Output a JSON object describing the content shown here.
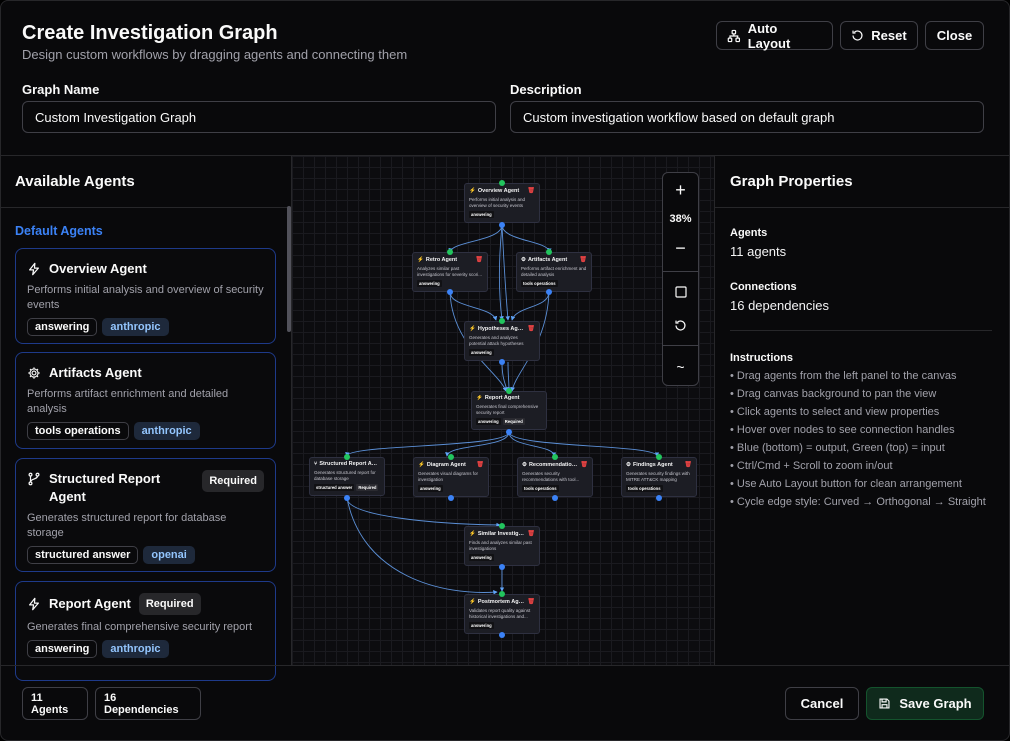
{
  "header": {
    "title": "Create Investigation Graph",
    "subtitle": "Design custom workflows by dragging agents and connecting them",
    "auto_layout_label": "Auto Layout",
    "reset_label": "Reset",
    "close_label": "Close"
  },
  "form": {
    "graph_name_label": "Graph Name",
    "graph_name_value": "Custom Investigation Graph",
    "description_label": "Description",
    "description_value": "Custom investigation workflow based on default graph"
  },
  "left_panel": {
    "title": "Available Agents",
    "section_label": "Default Agents",
    "agents": [
      {
        "name": "Overview Agent",
        "icon": "bolt-icon",
        "description": "Performs initial analysis and overview of security events",
        "tags": [
          "answering",
          "anthropic"
        ],
        "required": ""
      },
      {
        "name": "Artifacts Agent",
        "icon": "gear-icon",
        "description": "Performs artifact enrichment and detailed analysis",
        "tags": [
          "tools operations",
          "anthropic"
        ],
        "required": ""
      },
      {
        "name": "Structured Report Agent",
        "icon": "branch-icon",
        "description": "Generates structured report for database storage",
        "tags": [
          "structured answer",
          "openai"
        ],
        "required": "Required"
      },
      {
        "name": "Report Agent",
        "icon": "bolt-icon",
        "description": "Generates final comprehensive security report",
        "tags": [
          "answering",
          "anthropic"
        ],
        "required": "Required"
      }
    ]
  },
  "canvas": {
    "zoom_label": "38%",
    "nodes": [
      {
        "id": "overview",
        "title": "Overview Agent",
        "desc": "Performs initial analysis and overview of security events",
        "tags": [
          "answering"
        ]
      },
      {
        "id": "retro",
        "title": "Retro Agent",
        "desc": "Analyzes similar past investigations for severity scori...",
        "tags": [
          "answering"
        ]
      },
      {
        "id": "artifacts",
        "title": "Artifacts Agent",
        "desc": "Performs artifact enrichment and detailed analysis",
        "tags": [
          "tools operations"
        ]
      },
      {
        "id": "hypotheses",
        "title": "Hypotheses Agent",
        "desc": "Generates and analyzes potential attack hypotheses",
        "tags": [
          "answering"
        ]
      },
      {
        "id": "report",
        "title": "Report Agent",
        "desc": "Generates final comprehensive security report",
        "tags": [
          "answering",
          "Required"
        ]
      },
      {
        "id": "structured",
        "title": "Structured Report Agent",
        "desc": "Generates structured report for database storage",
        "tags": [
          "structured answer",
          "Required"
        ]
      },
      {
        "id": "diagram",
        "title": "Diagram Agent",
        "desc": "Generates visual diagrams for investigation",
        "tags": [
          "answering"
        ]
      },
      {
        "id": "recommendations",
        "title": "Recommendations ...",
        "desc": "Generates security recommendations with tool...",
        "tags": [
          "tools operations"
        ]
      },
      {
        "id": "findings",
        "title": "Findings Agent",
        "desc": "Generates security findings with MITRE ATT&CK mapping",
        "tags": [
          "tools operations"
        ]
      },
      {
        "id": "similar",
        "title": "Similar Investigatio...",
        "desc": "Finds and analyzes similar past investigations",
        "tags": [
          "answering"
        ]
      },
      {
        "id": "postmortem",
        "title": "Postmortem Agent",
        "desc": "Validates report quality against historical investigations and...",
        "tags": [
          "answering"
        ]
      }
    ]
  },
  "right_panel": {
    "title": "Graph Properties",
    "agents_label": "Agents",
    "agents_value": "11 agents",
    "connections_label": "Connections",
    "connections_value": "16 dependencies",
    "instructions_label": "Instructions",
    "instructions": [
      "Drag agents from the left panel to the canvas",
      "Drag canvas background to pan the view",
      "Click agents to select and view properties",
      "Hover over nodes to see connection handles",
      "Blue (bottom) = output, Green (top) = input",
      "Ctrl/Cmd + Scroll to zoom in/out",
      "Use Auto Layout button for clean arrangement",
      "Cycle edge style: Curved → Orthogonal → Straight"
    ]
  },
  "footer": {
    "agents_badge": "11 Agents",
    "deps_badge": "16 Dependencies",
    "cancel_label": "Cancel",
    "save_label": "Save Graph"
  },
  "colors": {
    "accent_blue": "#3b82f6",
    "input_handle": "#22c55e",
    "output_handle": "#3b82f6",
    "save_bg": "#0f2a1c",
    "delete_red": "#ef4444"
  }
}
